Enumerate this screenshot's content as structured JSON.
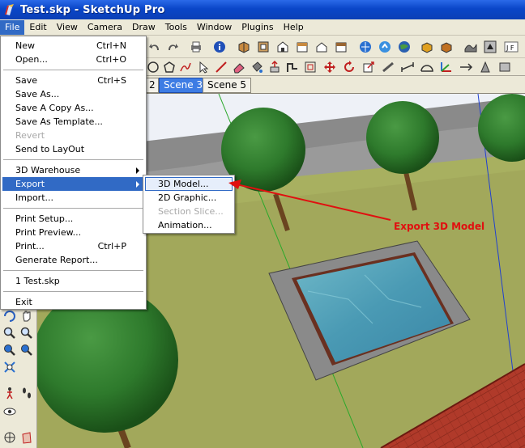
{
  "window": {
    "title": "Test.skp - SketchUp Pro"
  },
  "menubar": [
    "File",
    "Edit",
    "View",
    "Camera",
    "Draw",
    "Tools",
    "Window",
    "Plugins",
    "Help"
  ],
  "scenes": {
    "partial_tab": "2",
    "tabs": [
      "Scene 3",
      "Scene 5"
    ],
    "active": "Scene 3"
  },
  "file_menu": {
    "groups": [
      [
        {
          "label": "New",
          "shortcut": "Ctrl+N"
        },
        {
          "label": "Open...",
          "shortcut": "Ctrl+O"
        }
      ],
      [
        {
          "label": "Save",
          "shortcut": "Ctrl+S"
        },
        {
          "label": "Save As..."
        },
        {
          "label": "Save A Copy As..."
        },
        {
          "label": "Save As Template..."
        },
        {
          "label": "Revert",
          "disabled": true
        },
        {
          "label": "Send to LayOut"
        }
      ],
      [
        {
          "label": "3D Warehouse",
          "submenu": true
        },
        {
          "label": "Export",
          "submenu": true,
          "highlighted": true
        },
        {
          "label": "Import..."
        }
      ],
      [
        {
          "label": "Print Setup..."
        },
        {
          "label": "Print Preview..."
        },
        {
          "label": "Print...",
          "shortcut": "Ctrl+P"
        },
        {
          "label": "Generate Report..."
        }
      ],
      [
        {
          "label": "1 Test.skp"
        }
      ],
      [
        {
          "label": "Exit"
        }
      ]
    ]
  },
  "export_submenu": [
    {
      "label": "3D Model...",
      "hovered": true
    },
    {
      "label": "2D Graphic..."
    },
    {
      "label": "Section Slice...",
      "disabled": true
    },
    {
      "label": "Animation..."
    }
  ],
  "annotation": {
    "text": "Export 3D Model",
    "color": "#e01010"
  },
  "colors": {
    "selection": "#316ac5",
    "titlebar": "#0a46c8",
    "menubar": "#ece9d8"
  }
}
